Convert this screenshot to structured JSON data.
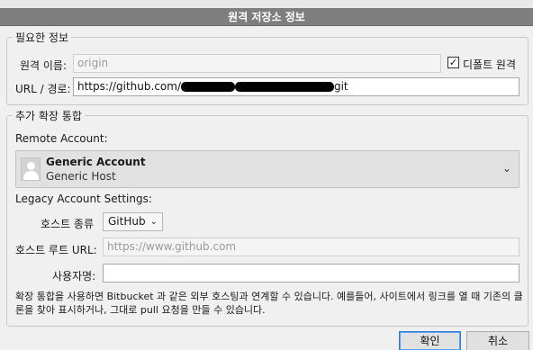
{
  "window": {
    "title": "원격 저장소 정보"
  },
  "required": {
    "legend": "필요한 정보",
    "remote_name_label": "원격 이름:",
    "remote_name_value": "origin",
    "default_remote_checked": true,
    "default_remote_label": "디폴트 원격",
    "url_label": "URL / 경로:",
    "url_prefix": "https://github.com/",
    "url_suffix": "git"
  },
  "extended": {
    "legend": "추가 확장 통합",
    "remote_account_label": "Remote Account:",
    "account_name": "Generic Account",
    "account_host": "Generic Host",
    "legacy_label": "Legacy Account Settings:",
    "host_type_label": "호스트 종류",
    "host_type_value": "GitHub",
    "host_root_label": "호스트 루트 URL:",
    "host_root_placeholder": "https://www.github.com",
    "username_label": "사용자명:",
    "username_value": "",
    "note": "확장 통합을 사용하면 Bitbucket 과 같은 외부 호스팅과 연계할 수 있습니다. 예를들어, 사이트에서 링크를 열 때 기존의 클론을 찾아 표시하거나, 그대로 pull 요청을 만들 수 있습니다."
  },
  "buttons": {
    "ok": "확인",
    "cancel": "취소"
  },
  "icons": {
    "checkbox": "check-icon",
    "avatar": "user-avatar-icon",
    "dropdown": "chevron-down-icon"
  }
}
